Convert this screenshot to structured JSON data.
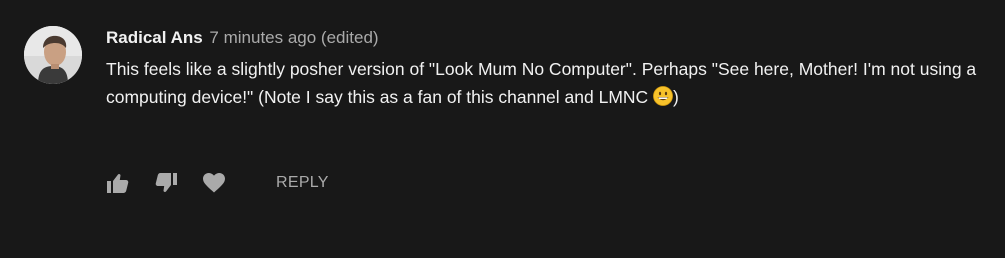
{
  "comment": {
    "author": "Radical Ans",
    "timestamp": "7 minutes ago (edited)",
    "text_part1": "This feels like a slightly posher version of \"Look Mum No Computer\". Perhaps \"See here, Mother! I'm not using a computing device!\" (Note I say this as a fan of this channel and LMNC ",
    "emoji": "grinning-face-emoji",
    "text_part2": ")"
  },
  "actions": {
    "like_icon": "thumbs-up-icon",
    "dislike_icon": "thumbs-down-icon",
    "heart_icon": "heart-icon",
    "reply_label": "REPLY"
  },
  "colors": {
    "background": "#181818",
    "primary_text": "#f1f1f1",
    "secondary_text": "#aaaaaa",
    "icon": "#aaaaaa"
  }
}
